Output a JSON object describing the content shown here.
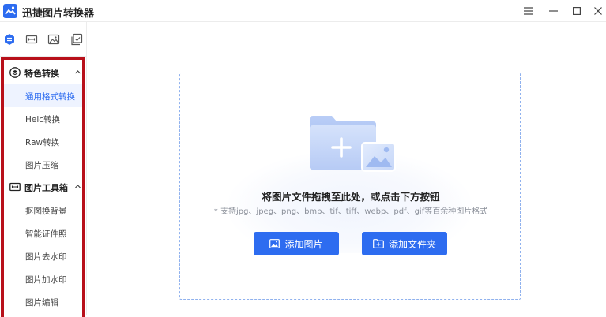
{
  "window": {
    "title": "迅捷图片转换器",
    "controls": [
      "menu-icon",
      "minimize-icon",
      "maximize-icon",
      "close-icon"
    ]
  },
  "colors": {
    "accent": "#2d6cf0",
    "highlight_frame": "#b8101a",
    "active_bg": "#eef3ff"
  },
  "toolbar_tabs": [
    "convert-icon",
    "ruler-icon",
    "image-icon",
    "layers-icon"
  ],
  "sidebar": {
    "groups": [
      {
        "label": "特色转换",
        "icon": "layers-circle-icon",
        "expanded": true,
        "items": [
          {
            "label": "通用格式转换",
            "active": true
          },
          {
            "label": "Heic转换",
            "active": false
          },
          {
            "label": "Raw转换",
            "active": false
          },
          {
            "label": "图片压缩",
            "active": false
          }
        ]
      },
      {
        "label": "图片工具箱",
        "icon": "toolbox-icon",
        "expanded": true,
        "items": [
          {
            "label": "抠图换背景",
            "active": false
          },
          {
            "label": "智能证件照",
            "active": false
          },
          {
            "label": "图片去水印",
            "active": false
          },
          {
            "label": "图片加水印",
            "active": false
          },
          {
            "label": "图片编辑",
            "active": false
          }
        ]
      }
    ]
  },
  "dropzone": {
    "icon": "folder-add-image-icon",
    "title": "将图片文件拖拽至此处，或点击下方按钮",
    "hint": "* 支持jpg、jpeg、png、bmp、tif、tiff、webp、pdf、gif等百余种图片格式",
    "add_image_label": "添加图片",
    "add_folder_label": "添加文件夹"
  }
}
